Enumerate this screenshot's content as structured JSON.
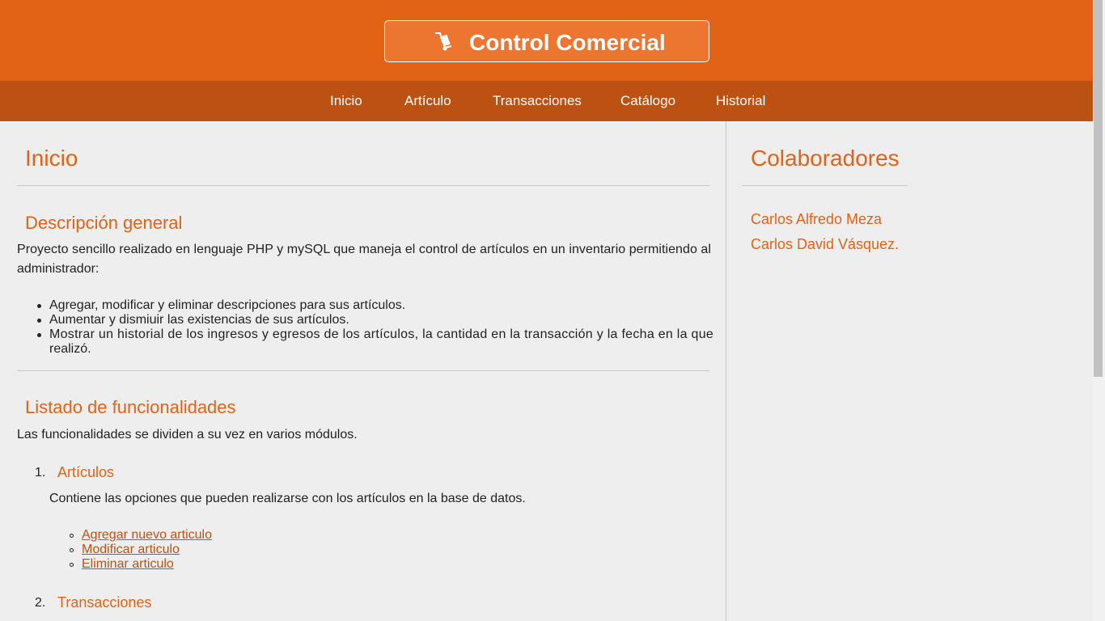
{
  "header": {
    "title": "Control Comercial",
    "icon": "hand-truck-icon"
  },
  "nav": {
    "items": [
      {
        "label": "Inicio"
      },
      {
        "label": "Artículo"
      },
      {
        "label": "Transacciones"
      },
      {
        "label": "Catálogo"
      },
      {
        "label": "Historial"
      }
    ]
  },
  "main": {
    "title": "Inicio",
    "overview": {
      "heading": "Descripción general",
      "intro_line1": "Proyecto sencillo realizado en lenguaje PHP y mySQL que maneja el control de artículos en un inventario permitiendo al",
      "intro_line2": "administrador:",
      "bullets": [
        "Agregar, modificar y eliminar descripciones para sus artículos.",
        "Aumentar y dismiuir las existencias de sus artículos.",
        "Mostrar un historial de los ingresos y egresos de los artículos, la cantidad en la transacción y la fecha en la que",
        "realizó."
      ]
    },
    "features": {
      "heading": "Listado de funcionalidades",
      "intro": "Las funcionalidades se dividen a su vez en varios módulos.",
      "modules": [
        {
          "number": "1.",
          "title": "Artículos",
          "description": "Contiene las opciones que pueden realizarse con los artículos en la base de datos.",
          "links": [
            "Agregar nuevo articulo",
            "Modificar articulo",
            "Eliminar articulo"
          ]
        },
        {
          "number": "2.",
          "title": "Transacciones"
        }
      ]
    }
  },
  "sidebar": {
    "title": "Colaboradores",
    "collaborators": [
      "Carlos Alfredo Meza",
      "Carlos David Vásquez."
    ]
  },
  "colors": {
    "accent": "#e26315",
    "nav": "#bc5212",
    "background": "#eeeeee"
  }
}
